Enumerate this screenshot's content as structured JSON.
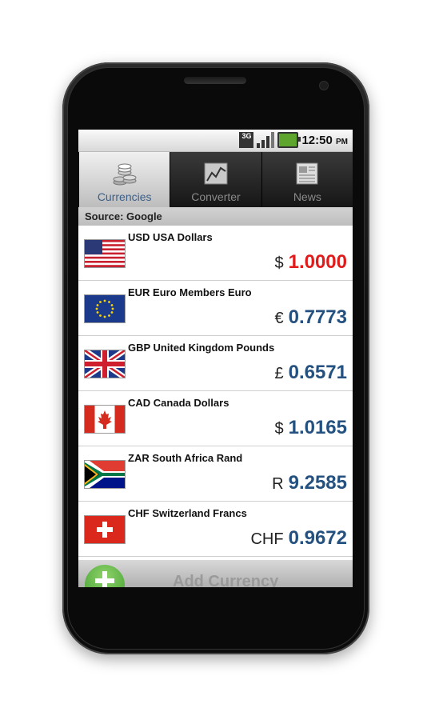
{
  "status": {
    "network": "3G",
    "time": "12:50",
    "ampm": "PM"
  },
  "tabs": [
    {
      "label": "Currencies",
      "icon": "coins-icon",
      "active": true
    },
    {
      "label": "Converter",
      "icon": "chart-icon",
      "active": false
    },
    {
      "label": "News",
      "icon": "newspaper-icon",
      "active": false
    }
  ],
  "source_label": "Source: Google",
  "currencies": [
    {
      "name": "USD USA Dollars",
      "symbol": "$",
      "value": "1.0000",
      "flag": "flag-usa-icon"
    },
    {
      "name": "EUR Euro Members Euro",
      "symbol": "€",
      "value": "0.7773",
      "flag": "flag-eu-icon"
    },
    {
      "name": "GBP United Kingdom Pounds",
      "symbol": "£",
      "value": "0.6571",
      "flag": "flag-uk-icon"
    },
    {
      "name": "CAD Canada Dollars",
      "symbol": "$",
      "value": "1.0165",
      "flag": "flag-canada-icon"
    },
    {
      "name": "ZAR South Africa Rand",
      "symbol": "R",
      "value": "9.2585",
      "flag": "flag-south-africa-icon"
    },
    {
      "name": "CHF Switzerland Francs",
      "symbol": "CHF",
      "value": "0.9672",
      "flag": "flag-switzerland-icon"
    }
  ],
  "add_label": "Add Currency",
  "colors": {
    "base_value": "#e01b1b",
    "value": "#24517f",
    "active_tab_text": "#3b5f8a"
  }
}
